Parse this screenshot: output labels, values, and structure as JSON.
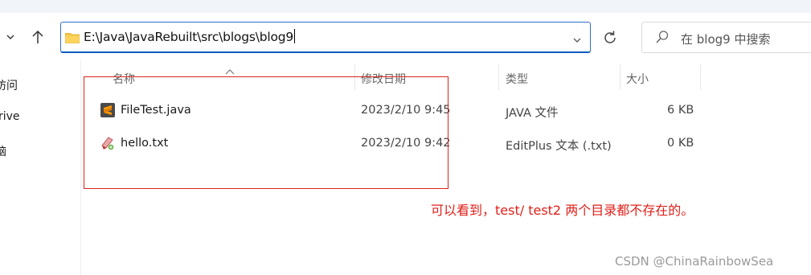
{
  "address_bar": {
    "path": "E:\\Java\\JavaRebuilt\\src\\blogs\\blog9",
    "folder_icon": "folder-icon",
    "dropdown_icon": "chevron-down-icon"
  },
  "navigation": {
    "back_chevron_icon": "chevron-down-icon",
    "up_icon": "arrow-up-icon",
    "refresh_icon": "refresh-icon"
  },
  "search": {
    "placeholder": "在 blog9 中搜索",
    "icon": "search-icon"
  },
  "nav_pane": {
    "items": [
      {
        "label": "访问"
      },
      {
        "label": "rive"
      },
      {
        "label": "脑"
      }
    ]
  },
  "columns": {
    "name": "名称",
    "modified": "修改日期",
    "type": "类型",
    "size": "大小"
  },
  "files": [
    {
      "name": "FileTest.java",
      "modified": "2023/2/10 9:45",
      "type": "JAVA 文件",
      "size": "6 KB",
      "icon": "sublime-text-icon"
    },
    {
      "name": "hello.txt",
      "modified": "2023/2/10 9:42",
      "type": "EditPlus 文本 (.txt)",
      "size": "0 KB",
      "icon": "editplus-file-icon"
    }
  ],
  "annotation": {
    "text": "可以看到，test/ test2 两个目录都不存在的。",
    "color": "#e0201a"
  },
  "watermark": {
    "text": "CSDN @ChinaRainbowSea"
  },
  "colors": {
    "accent": "#0b5cc2",
    "highlight_box": "#d9261c"
  }
}
